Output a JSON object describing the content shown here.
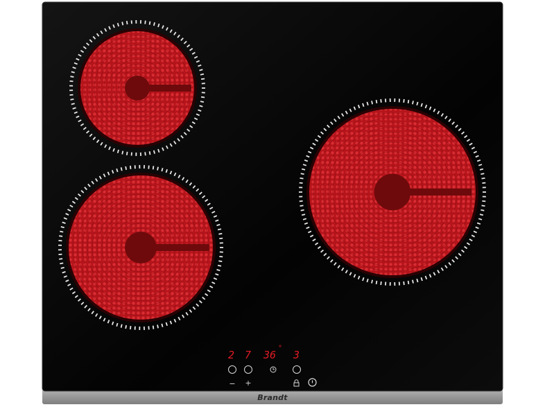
{
  "product": {
    "brand": "Brandt"
  },
  "display": {
    "left_level": "2",
    "right_level": "7",
    "timer": "36",
    "timer_dot": "°",
    "far_right_level": "3"
  },
  "controls": {
    "minus_label": "−",
    "plus_label": "+",
    "timer_icon": "clock-icon",
    "lock_icon": "lock-icon",
    "power_icon": "power-icon"
  },
  "colors": {
    "glass": "#050505",
    "frame": "#8f8f8f",
    "burner_hot": "#d21a1f",
    "burner_dark": "#6e0a0c",
    "display_red": "#e01b24",
    "ring_white": "#e8e8e8"
  },
  "zones": [
    {
      "name": "top-left-cooking-zone"
    },
    {
      "name": "bottom-left-cooking-zone"
    },
    {
      "name": "right-cooking-zone"
    }
  ]
}
